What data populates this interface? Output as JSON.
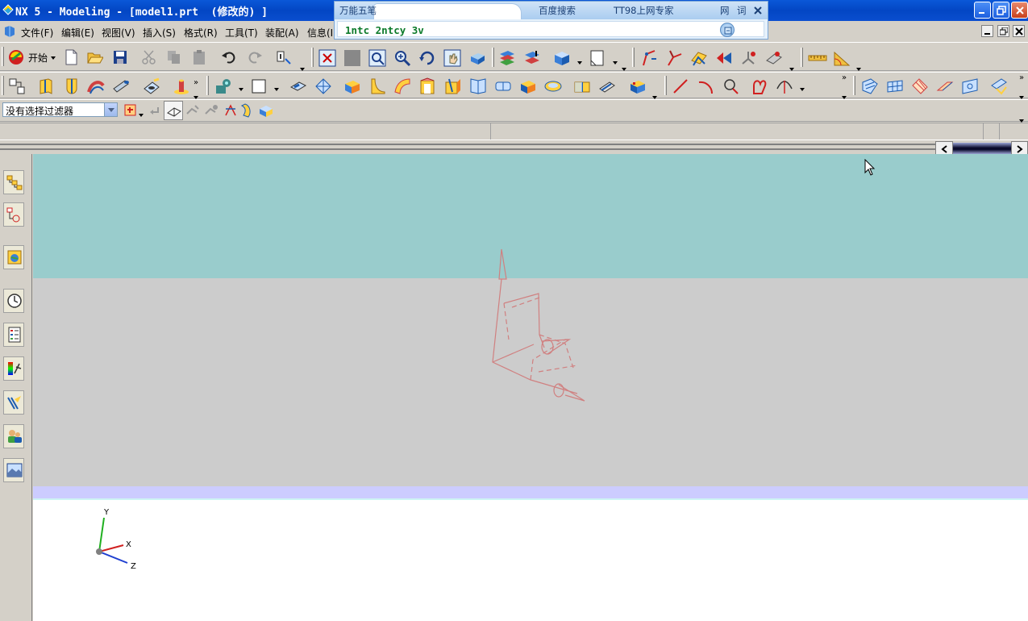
{
  "window": {
    "title": "NX 5 - Modeling - [model1.prt  (修改的) ]"
  },
  "ime": {
    "tabs": [
      "万能五笔",
      "百度搜索",
      "TT98上网专家",
      "网",
      "词"
    ],
    "input_text": "1ntc 2ntcy 3v"
  },
  "menu": {
    "items": [
      "文件(F)",
      "编辑(E)",
      "视图(V)",
      "插入(S)",
      "格式(R)",
      "工具(T)",
      "装配(A)",
      "信息(I)"
    ]
  },
  "toolbar": {
    "start_label": "开始",
    "filter_value": "没有选择过滤器"
  },
  "viewport": {
    "axis_labels": [
      "Y",
      "X",
      "Z"
    ],
    "sky_color": "#99cccc",
    "floor_color": "#cccccc",
    "ground_band_color": "#ccccff",
    "triad_x_color": "#d02020",
    "triad_y_color": "#20b020",
    "triad_z_color": "#2040d0",
    "model_color": "#d08080"
  }
}
